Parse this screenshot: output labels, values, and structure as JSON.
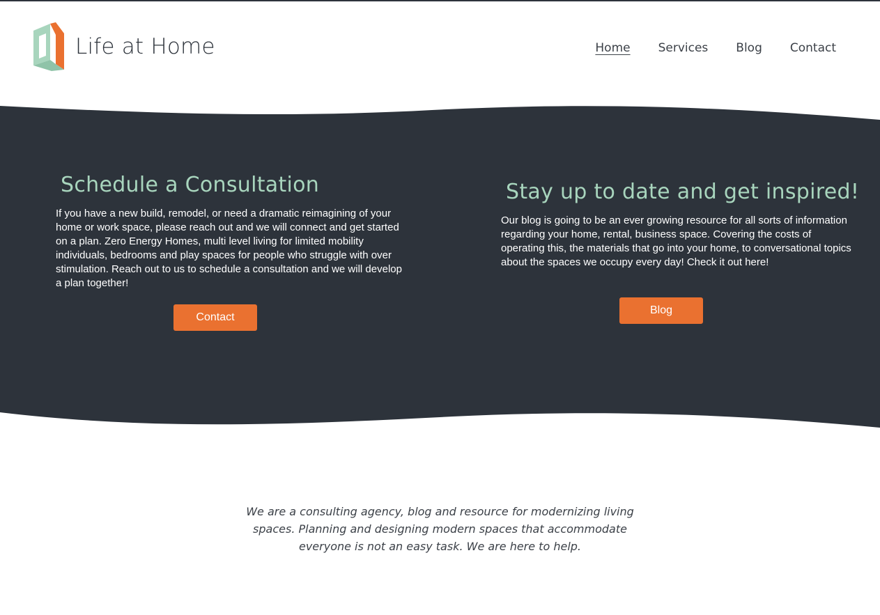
{
  "header": {
    "logo_text": "Life at Home",
    "logo_icon": "house-outline-icon",
    "nav": [
      {
        "label": "Home",
        "active": true
      },
      {
        "label": "Services",
        "active": false
      },
      {
        "label": "Blog",
        "active": false
      },
      {
        "label": "Contact",
        "active": false
      }
    ]
  },
  "consultation": {
    "heading": "Schedule a Consultation",
    "body": "If you have a new build, remodel, or need a dramatic reimagining of your home or work space, please reach out and we will connect and get started on a plan. Zero Energy Homes, multi level living for limited mobility individuals, bedrooms and play spaces for people who struggle with over stimulation. Reach out to us to schedule a consultation and we will develop a plan together!",
    "button_label": "Contact"
  },
  "blog": {
    "heading": "Stay up to date and get inspired!",
    "body": "Our blog is going to be an ever growing resource for all sorts of information regarding your home, rental, business space. Covering the costs of operating this, the materials that go into your home, to conversational topics about the spaces we occupy every day! Check it out here!",
    "button_label": "Blog"
  },
  "tagline": "We are a consulting agency, blog and resource for modernizing living spaces. Planning and designing modern spaces that accommodate everyone is not an easy task. We are here to help.",
  "colors": {
    "dark_band": "#2d333b",
    "accent_orange": "#ea7130",
    "heading_mint": "#a8d5bd",
    "logo_mint": "#a8d5bd"
  }
}
